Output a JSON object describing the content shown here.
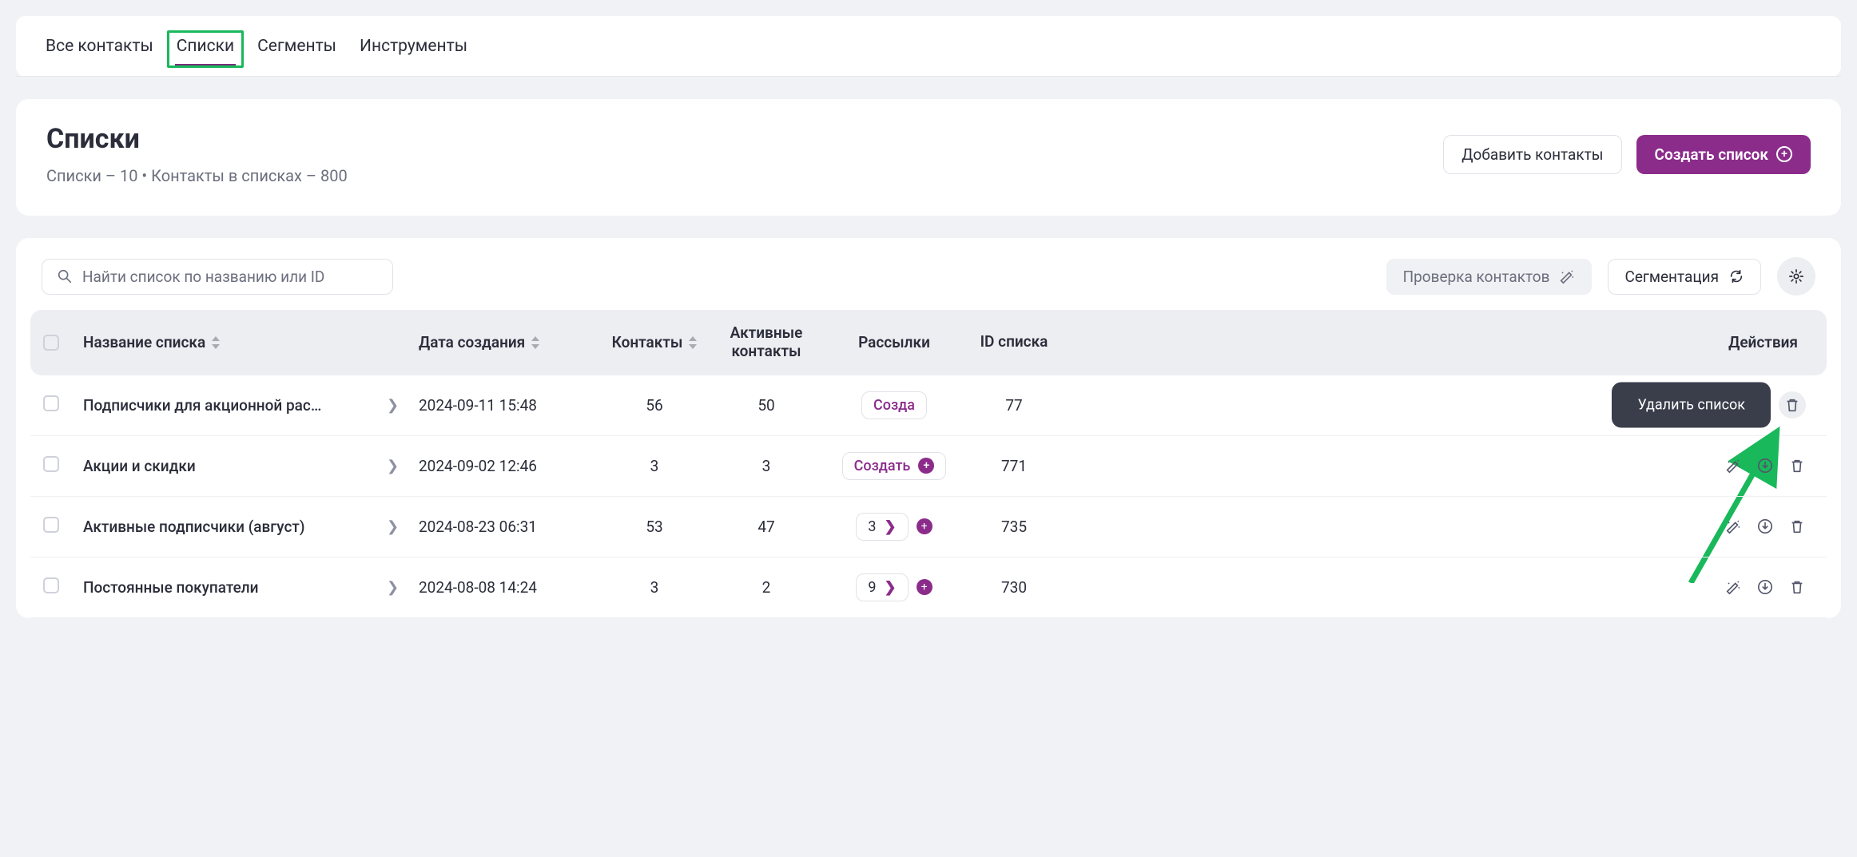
{
  "tabs": {
    "all_contacts": "Все контакты",
    "lists": "Списки",
    "segments": "Сегменты",
    "tools": "Инструменты"
  },
  "header": {
    "title": "Списки",
    "subtitle": "Списки – 10 • Контакты в списках – 800",
    "add_contacts": "Добавить контакты",
    "create_list": "Создать список"
  },
  "toolbar": {
    "search_placeholder": "Найти список по названию или ID",
    "verify_contacts": "Проверка контактов",
    "segmentation": "Сегментация"
  },
  "columns": {
    "name": "Название списка",
    "created": "Дата создания",
    "contacts": "Контакты",
    "active": "Активные контакты",
    "mailings": "Рассылки",
    "id": "ID списка",
    "actions": "Действия"
  },
  "tooltip": {
    "delete_list": "Удалить список"
  },
  "mailings_create_label": "Создать",
  "rows": [
    {
      "name": "Подписчики для акционной рас…",
      "created": "2024-09-11 15:48",
      "contacts": "56",
      "active": "50",
      "mailings_mode": "create_partial",
      "mailings_label": "Созда",
      "id_partial": "77",
      "tooltip": true,
      "highlight_trash": true
    },
    {
      "name": "Акции и скидки",
      "created": "2024-09-02 12:46",
      "contacts": "3",
      "active": "3",
      "mailings_mode": "create",
      "id": "771"
    },
    {
      "name": "Активные подписчики (август)",
      "created": "2024-08-23 06:31",
      "contacts": "53",
      "active": "47",
      "mailings_mode": "number",
      "mailings_count": "3",
      "id": "735"
    },
    {
      "name": "Постоянные покупатели",
      "created": "2024-08-08 14:24",
      "contacts": "3",
      "active": "2",
      "mailings_mode": "number",
      "mailings_count": "9",
      "id": "730"
    }
  ]
}
